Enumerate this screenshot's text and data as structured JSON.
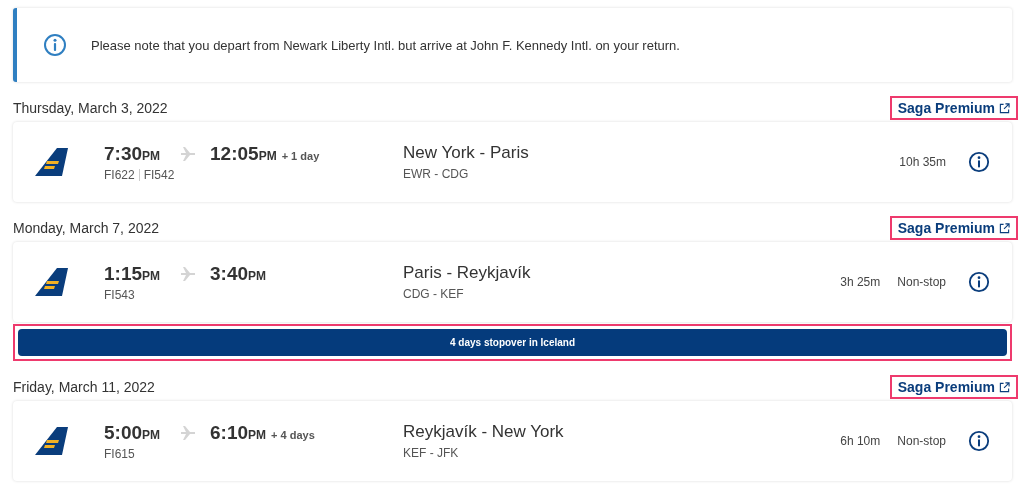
{
  "notice": {
    "text": "Please note that you depart from Newark Liberty Intl. but arrive at John F. Kennedy Intl. on your return."
  },
  "legs": [
    {
      "date": "Thursday, March 3, 2022",
      "fare_link": "Saga Premium",
      "highlighted": true,
      "depart": "7:30",
      "depart_period": "PM",
      "arrive": "12:05",
      "arrive_period": "PM",
      "day_offset": "+ 1 day",
      "flights": [
        "FI622",
        "FI542"
      ],
      "route": "New York - Paris",
      "airports": "EWR - CDG",
      "duration": "10h 35m"
    },
    {
      "date": "Monday, March 7, 2022",
      "fare_link": "Saga Premium",
      "highlighted": true,
      "depart": "1:15",
      "depart_period": "PM",
      "arrive": "3:40",
      "arrive_period": "PM",
      "flights": [
        "FI543"
      ],
      "route": "Paris - Reykjavík",
      "airports": "CDG - KEF",
      "duration": "3h 25m",
      "stops": "Non-stop",
      "stopover": {
        "text": "4 days stopover in Iceland",
        "highlighted": true
      }
    },
    {
      "date": "Friday, March 11, 2022",
      "fare_link": "Saga Premium",
      "highlighted": true,
      "depart": "5:00",
      "depart_period": "PM",
      "arrive": "6:10",
      "arrive_period": "PM",
      "day_offset": "+ 4 days",
      "flights": [
        "FI615"
      ],
      "route": "Reykjavík - New York",
      "airports": "KEF - JFK",
      "duration": "6h 10m",
      "stops": "Non-stop"
    }
  ]
}
